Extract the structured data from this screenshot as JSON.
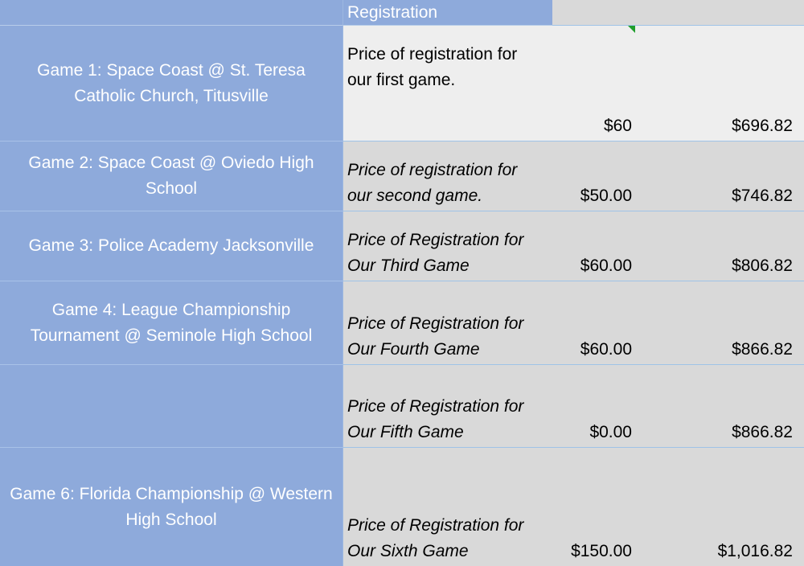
{
  "header": {
    "column_label": "Registration"
  },
  "rows": [
    {
      "game": "Game 1:  Space Coast @ St. Teresa Catholic Church, Titusville",
      "desc_line1": "Price of registration for",
      "desc_line2": "our first game.",
      "price": "$60",
      "total": "$696.82"
    },
    {
      "game": "Game 2: Space Coast @ Oviedo High School",
      "desc_line1": "Price of registration for",
      "desc_line2": "our second game.",
      "price": "$50.00",
      "total": "$746.82"
    },
    {
      "game": "Game 3: Police Academy Jacksonville",
      "desc_line1": "Price of Registration for",
      "desc_line2": "Our Third Game",
      "price": "$60.00",
      "total": "$806.82"
    },
    {
      "game": "Game 4: League Championship Tournament @  Seminole High School",
      "desc_line1": "Price of Registration for",
      "desc_line2": "Our Fourth Game",
      "price": "$60.00",
      "total": "$866.82"
    },
    {
      "game": "",
      "desc_line1": "Price of Registration for",
      "desc_line2": "Our Fifth Game",
      "price": "$0.00",
      "total": "$866.82"
    },
    {
      "game": "Game 6: Florida Championship @ Western High School",
      "desc_line1": "Price of Registration for",
      "desc_line2": "Our Sixth Game",
      "price": "$150.00",
      "total": "$1,016.82"
    }
  ],
  "colors": {
    "game_column": "#8eaadb",
    "cell_fill": "#d9d9d9",
    "selected_row_fill": "#eeeeee",
    "comment_marker": "#1f9e2c"
  }
}
